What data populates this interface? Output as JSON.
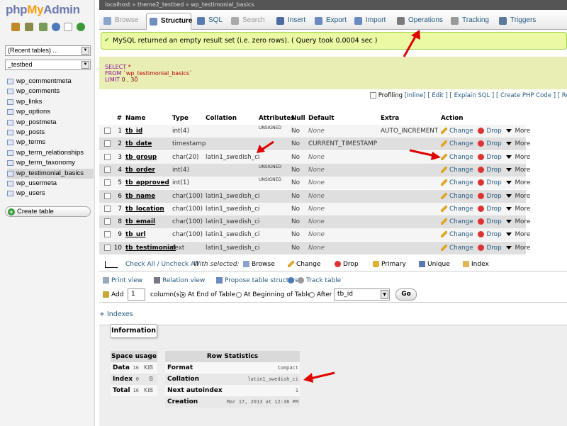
{
  "app": {
    "logo_php": "php",
    "logo_my": "My",
    "logo_admin": "Admin"
  },
  "sidebar": {
    "recent_select": "(Recent tables) ...",
    "db_select": "_testbed",
    "tables": [
      "wp_commentmeta",
      "wp_comments",
      "wp_links",
      "wp_options",
      "wp_postmeta",
      "wp_posts",
      "wp_terms",
      "wp_term_relationships",
      "wp_term_taxonomy",
      "wp_testimonial_basics",
      "wp_usermeta",
      "wp_users"
    ],
    "active_table": "wp_testimonial_basics",
    "create_table": "Create table"
  },
  "breadcrumb": "localhost  »  theme2_testbed  »  wp_testimonial_basics",
  "tabs": [
    {
      "label": "Browse",
      "icon": "browse-icon",
      "disabled": true
    },
    {
      "label": "Structure",
      "icon": "structure-icon",
      "active": true
    },
    {
      "label": "SQL",
      "icon": "sql-icon"
    },
    {
      "label": "Search",
      "icon": "search-icon",
      "disabled": true
    },
    {
      "label": "Insert",
      "icon": "insert-icon"
    },
    {
      "label": "Export",
      "icon": "export-icon"
    },
    {
      "label": "Import",
      "icon": "import-icon"
    },
    {
      "label": "Operations",
      "icon": "wrench-icon"
    },
    {
      "label": "Tracking",
      "icon": "eye-icon"
    },
    {
      "label": "Triggers",
      "icon": "triggers-icon"
    }
  ],
  "message": "MySQL returned an empty result set (i.e. zero rows). ( Query took 0.0004 sec )",
  "sql": {
    "select_kw": "SELECT",
    "select_rest": " *",
    "from_kw": "FROM",
    "from_rest": " `wp_testimonial_basics`",
    "limit_kw": "LIMIT",
    "limit_rest": " 0 , 30"
  },
  "profiling": {
    "label": "Profiling",
    "links": [
      "[Inline]",
      "[ Edit ]",
      "[ Explain SQL ]",
      "[ Create PHP Code ]",
      "[ Refresh ]"
    ]
  },
  "columns_header": {
    "num": "#",
    "name": "Name",
    "type": "Type",
    "collation": "Collation",
    "attributes": "Attributes",
    "null": "Null",
    "default": "Default",
    "extra": "Extra",
    "action": "Action"
  },
  "columns": [
    {
      "num": "1",
      "name": "tb_id",
      "type": "int(4)",
      "collation": "",
      "attr": "UNSIGNED",
      "null": "No",
      "default": "None",
      "extra": "AUTO_INCREMENT"
    },
    {
      "num": "2",
      "name": "tb_date",
      "type": "timestamp",
      "collation": "",
      "attr": "",
      "null": "No",
      "default": "CURRENT_TIMESTAMP",
      "extra": ""
    },
    {
      "num": "3",
      "name": "tb_group",
      "type": "char(20)",
      "collation": "latin1_swedish_ci",
      "attr": "",
      "null": "No",
      "default": "None",
      "extra": ""
    },
    {
      "num": "4",
      "name": "tb_order",
      "type": "int(4)",
      "collation": "",
      "attr": "UNSIGNED",
      "null": "No",
      "default": "None",
      "extra": ""
    },
    {
      "num": "5",
      "name": "tb_approved",
      "type": "int(1)",
      "collation": "",
      "attr": "UNSIGNED",
      "null": "No",
      "default": "None",
      "extra": ""
    },
    {
      "num": "6",
      "name": "tb_name",
      "type": "char(100)",
      "collation": "latin1_swedish_ci",
      "attr": "",
      "null": "No",
      "default": "None",
      "extra": ""
    },
    {
      "num": "7",
      "name": "tb_location",
      "type": "char(100)",
      "collation": "latin1_swedish_ci",
      "attr": "",
      "null": "No",
      "default": "None",
      "extra": ""
    },
    {
      "num": "8",
      "name": "tb_email",
      "type": "char(100)",
      "collation": "latin1_swedish_ci",
      "attr": "",
      "null": "No",
      "default": "None",
      "extra": ""
    },
    {
      "num": "9",
      "name": "tb_url",
      "type": "char(100)",
      "collation": "latin1_swedish_ci",
      "attr": "",
      "null": "No",
      "default": "None",
      "extra": ""
    },
    {
      "num": "10",
      "name": "tb_testimonial",
      "type": "text",
      "collation": "latin1_swedish_ci",
      "attr": "",
      "null": "No",
      "default": "None",
      "extra": ""
    }
  ],
  "actions": {
    "change": "Change",
    "drop": "Drop",
    "more": "More"
  },
  "with_selected": {
    "check_all": "Check All / Uncheck All",
    "with_selected": "With selected:",
    "browse": "Browse",
    "change": "Change",
    "drop": "Drop",
    "primary": "Primary",
    "unique": "Unique",
    "index": "Index"
  },
  "links_row": {
    "print_view": "Print view",
    "relation_view": "Relation view",
    "propose": "Propose table structure",
    "track": "Track table"
  },
  "add_row": {
    "add": "Add",
    "count": "1",
    "columns_label": "column(s)",
    "at_end": "At End of Table",
    "at_beginning": "At Beginning of Table",
    "after": "After",
    "after_field": "tb_id",
    "go": "Go"
  },
  "indexes_link": "+ Indexes",
  "information": {
    "legend": "Information",
    "space_usage": {
      "title": "Space usage",
      "rows": [
        {
          "k": "Data",
          "v": "16",
          "u": "KiB"
        },
        {
          "k": "Index",
          "v": "0",
          "u": "B"
        },
        {
          "k": "Total",
          "v": "16",
          "u": "KiB"
        }
      ]
    },
    "row_statistics": {
      "title": "Row Statistics",
      "rows": [
        {
          "k": "Format",
          "v": "Compact"
        },
        {
          "k": "Collation",
          "v": "latin1_swedish_ci"
        },
        {
          "k": "Next autoindex",
          "v": "1"
        },
        {
          "k": "Creation",
          "v": "Mar 17, 2013 at 12:38 PM"
        }
      ]
    }
  },
  "colors": {
    "link": "#235a81",
    "success_bg": "#ebf8a4",
    "annotation_arrow": "#e00000"
  }
}
